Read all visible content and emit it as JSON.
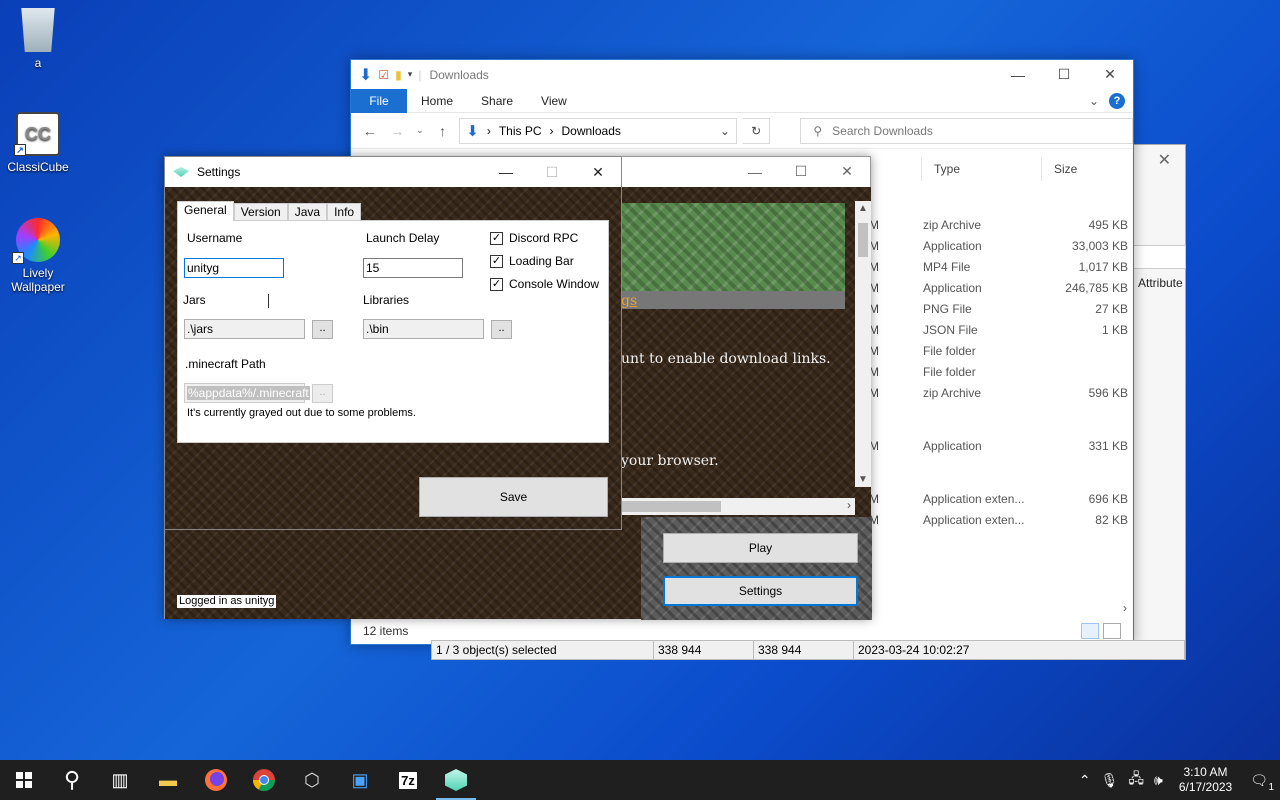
{
  "desktop": {
    "icons": [
      {
        "label": "a"
      },
      {
        "label": "ClassiCube"
      },
      {
        "label": "Lively Wallpaper"
      }
    ]
  },
  "explorer": {
    "title": "Downloads",
    "ribbon_tabs": [
      "File",
      "Home",
      "Share",
      "View"
    ],
    "path": [
      "This PC",
      "Downloads"
    ],
    "search_placeholder": "Search Downloads",
    "columns": [
      "Type",
      "Size"
    ],
    "rows": [
      {
        "time": "AM",
        "type": "zip Archive",
        "size": "495 KB"
      },
      {
        "time": "AM",
        "type": "Application",
        "size": "33,003 KB"
      },
      {
        "time": "AM",
        "type": "MP4 File",
        "size": "1,017 KB"
      },
      {
        "time": "AM",
        "type": "Application",
        "size": "246,785 KB"
      },
      {
        "time": "AM",
        "type": "PNG File",
        "size": "27 KB"
      },
      {
        "time": "AM",
        "type": "JSON File",
        "size": "1 KB"
      },
      {
        "time": "AM",
        "type": "File folder",
        "size": ""
      },
      {
        "time": "AM",
        "type": "File folder",
        "size": ""
      },
      {
        "time": "AM",
        "type": "zip Archive",
        "size": "596 KB"
      }
    ],
    "rows2": [
      {
        "time": "AM",
        "type": "Application",
        "size": "331 KB"
      }
    ],
    "rows3": [
      {
        "time": "PM",
        "type": "Application exten...",
        "size": "696 KB"
      },
      {
        "time": "PM",
        "type": "Application exten...",
        "size": "82 KB"
      }
    ],
    "status": "12 items"
  },
  "backwindow": {
    "attr_label": "Attribute"
  },
  "detail_bar": {
    "cells": [
      "1 / 3 object(s) selected",
      "338 944",
      "338 944",
      "2023-03-24 10:02:27"
    ]
  },
  "launcher": {
    "news_link": "gs",
    "news_text1": "unt to enable download links.",
    "news_text2": "your browser.",
    "play_label": "Play",
    "settings_label": "Settings",
    "logged_in": "Logged in as unityg"
  },
  "settings": {
    "title": "Settings",
    "tabs": [
      "General",
      "Version",
      "Java",
      "Info"
    ],
    "username_label": "Username",
    "username_value": "unityg",
    "launch_delay_label": "Launch Delay",
    "launch_delay_value": "15",
    "jars_label": "Jars",
    "jars_value": ".\\jars",
    "libraries_label": "Libraries",
    "libraries_value": ".\\bin",
    "browse_label": "..",
    "mc_path_label": ".minecraft Path",
    "mc_path_value": "%appdata%/.minecraft",
    "mc_path_note": "It's currently grayed out due to some problems.",
    "checkboxes": [
      {
        "label": "Discord RPC",
        "checked": true
      },
      {
        "label": "Loading Bar",
        "checked": true
      },
      {
        "label": "Console Window",
        "checked": true
      }
    ],
    "save_label": "Save"
  },
  "taskbar": {
    "time": "3:10 AM",
    "date": "6/17/2023",
    "notification_count": "1"
  }
}
